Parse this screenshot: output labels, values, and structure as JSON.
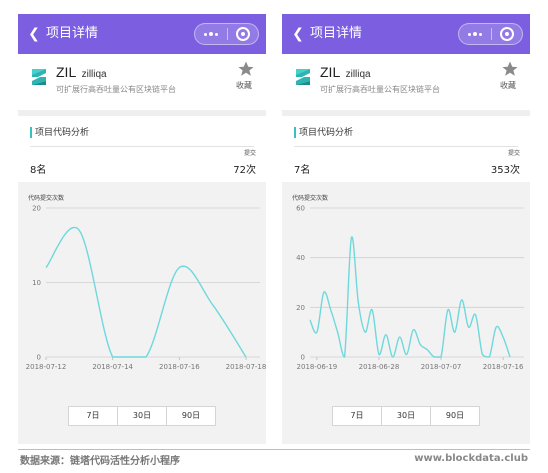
{
  "colors": {
    "navbar": "#7b5fe0",
    "accent": "#36c2c0",
    "line": "#6fd8dc"
  },
  "panels": [
    {
      "nav": {
        "back_icon": "chevron-left-icon",
        "title": "项目详情"
      },
      "project": {
        "logo_icon": "zilliqa-logo-icon",
        "symbol": "ZIL",
        "name": "zilliqa",
        "description": "可扩展行高吞吐量公有区块链平台",
        "favorite_icon": "star-icon",
        "favorite_label": "收藏"
      },
      "section_title": "项目代码分析",
      "stat_label": "提交",
      "rank": "8名",
      "commits": "72次",
      "range_tabs": [
        "7日",
        "30日",
        "90日"
      ]
    },
    {
      "nav": {
        "back_icon": "chevron-left-icon",
        "title": "项目详情"
      },
      "project": {
        "logo_icon": "zilliqa-logo-icon",
        "symbol": "ZIL",
        "name": "zilliqa",
        "description": "可扩展行高吞吐量公有区块链平台",
        "favorite_icon": "star-icon",
        "favorite_label": "收藏"
      },
      "section_title": "项目代码分析",
      "stat_label": "提交",
      "rank": "7名",
      "commits": "353次",
      "range_tabs": [
        "7日",
        "30日",
        "90日"
      ]
    }
  ],
  "chart_data": [
    {
      "type": "line",
      "title": "代码提交次数",
      "xlabel": "",
      "ylabel": "",
      "x_ticks": [
        "2018-07-12",
        "2018-07-14",
        "2018-07-16",
        "2018-07-18"
      ],
      "y_ticks": [
        0,
        10,
        20
      ],
      "ylim": [
        0,
        20
      ],
      "grid": true,
      "series": [
        {
          "x": [
            "2018-07-12",
            "2018-07-13",
            "2018-07-14",
            "2018-07-15",
            "2018-07-16",
            "2018-07-17",
            "2018-07-18"
          ],
          "values": [
            12,
            17,
            0,
            0,
            12,
            7,
            0
          ]
        }
      ]
    },
    {
      "type": "line",
      "title": "代码提交次数",
      "xlabel": "",
      "ylabel": "",
      "x_ticks": [
        "2018-06-19",
        "2018-06-28",
        "2018-07-07",
        "2018-07-16"
      ],
      "y_ticks": [
        0,
        20,
        40,
        60
      ],
      "ylim": [
        0,
        60
      ],
      "grid": true,
      "series": [
        {
          "x": [
            "2018-06-18",
            "2018-06-19",
            "2018-06-20",
            "2018-06-21",
            "2018-06-22",
            "2018-06-23",
            "2018-06-24",
            "2018-06-25",
            "2018-06-26",
            "2018-06-27",
            "2018-06-28",
            "2018-06-29",
            "2018-06-30",
            "2018-07-01",
            "2018-07-02",
            "2018-07-03",
            "2018-07-04",
            "2018-07-05",
            "2018-07-06",
            "2018-07-07",
            "2018-07-08",
            "2018-07-09",
            "2018-07-10",
            "2018-07-11",
            "2018-07-12",
            "2018-07-13",
            "2018-07-14",
            "2018-07-15",
            "2018-07-16",
            "2018-07-17"
          ],
          "values": [
            15,
            10,
            26,
            19,
            10,
            0,
            48,
            22,
            10,
            19,
            1,
            9,
            0,
            8,
            1,
            11,
            5,
            3,
            0,
            0,
            19,
            10,
            23,
            12,
            17,
            1,
            0,
            12,
            8,
            0
          ]
        }
      ]
    }
  ],
  "footer": {
    "source": "数据来源：链塔代码活性分析小程序",
    "site": "www.blockdata.club"
  }
}
